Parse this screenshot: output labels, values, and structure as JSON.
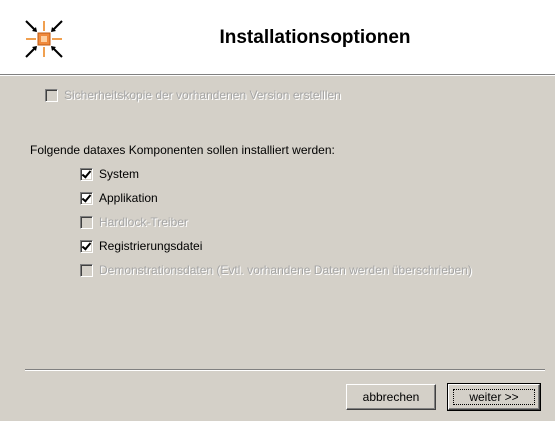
{
  "header": {
    "title": "Installationsoptionen",
    "logo_icon": "installer-arrows-icon",
    "background": "#ffffff"
  },
  "backup_option": {
    "label": "Sicherheitskopie der vorhandenen Version erstelllen",
    "checked": false,
    "enabled": false
  },
  "components": {
    "intro": "Folgende dataxes Komponenten sollen installiert werden:",
    "items": [
      {
        "label": "System",
        "checked": true,
        "enabled": true
      },
      {
        "label": "Applikation",
        "checked": true,
        "enabled": true
      },
      {
        "label": "Hardlock-Treiber",
        "checked": false,
        "enabled": false
      },
      {
        "label": "Registrierungsdatei",
        "checked": true,
        "enabled": true
      },
      {
        "label": "Demonstrationsdaten (Evtl. vorhandene Daten werden überschrieben)",
        "checked": false,
        "enabled": false
      }
    ]
  },
  "buttons": {
    "cancel_label": "abbrechen",
    "next_label": "weiter >>"
  },
  "colors": {
    "dialog_background": "#d4d0c8",
    "disabled_text": "#a6a6a6",
    "logo_accent": "#f0a050"
  }
}
